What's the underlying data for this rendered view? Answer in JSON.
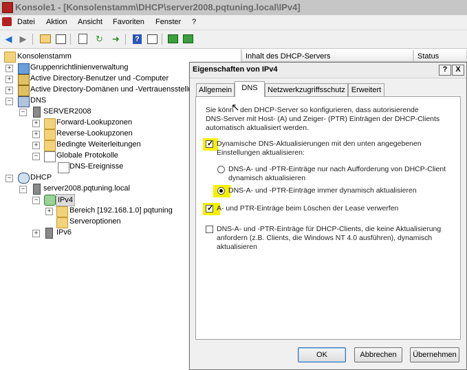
{
  "window": {
    "title": "Konsole1 - [Konsolenstamm\\DHCP\\server2008.pqtuning.local\\IPv4]"
  },
  "menu": [
    "Datei",
    "Aktion",
    "Ansicht",
    "Favoriten",
    "Fenster",
    "?"
  ],
  "toolbar": [
    "back-icon",
    "forward-icon",
    "up-folder-icon",
    "show-tree-icon",
    "properties-icon",
    "refresh-icon",
    "export-icon",
    "help-icon",
    "show-action-icon",
    "monitor-icon",
    "network-icon"
  ],
  "tree": {
    "root": "Konsolenstamm",
    "items": [
      "Gruppenrichtlinienverwaltung",
      "Active Directory-Benutzer und -Computer",
      "Active Directory-Domänen und -Vertrauensstellu",
      "DNS",
      "SERVER2008",
      "Forward-Lookupzonen",
      "Reverse-Lookupzonen",
      "Bedingte Weiterleitungen",
      "Globale Protokolle",
      "DNS-Ereignisse",
      "DHCP",
      "server2008.pqtuning.local",
      "IPv4",
      "Bereich [192.168.1.0] pqtuning",
      "Serveroptionen",
      "IPv6"
    ]
  },
  "rightpane": {
    "columns": [
      "Inhalt des DHCP-Servers",
      "Status"
    ]
  },
  "dialog": {
    "title": "Eigenschaften von IPv4",
    "help_btn": "?",
    "close_btn": "X",
    "tabs": [
      "Allgemein",
      "DNS",
      "Netzwerkzugriffsschutz",
      "Erweitert"
    ],
    "active_tab": "DNS",
    "intro": [
      "Sie könn",
      "den DHCP-Server so konfigurieren, dass autorisierende",
      "DNS-Server mit Host- (A) und Zeiger- (PTR) Einträgen der DHCP-Clients",
      "automatisch aktualisiert werden."
    ],
    "dyn_update": {
      "label": [
        "Dynamische DNS-Aktualisierungen mit den unten angegebenen",
        "Einstellungen aktualisieren:"
      ],
      "checked": true
    },
    "radio_on_request": {
      "label": [
        "DNS-A- und -PTR-Einträge nur nach Aufforderung von DHCP-Client",
        "dynamisch aktualisieren"
      ],
      "selected": false
    },
    "radio_always": {
      "label": "DNS-A- und -PTR-Einträge immer dynamisch aktualisieren",
      "selected": true
    },
    "discard_lease": {
      "label": "A- und PTR-Einträge beim Löschen der Lease verwerfen",
      "checked": true
    },
    "no_update_clients": {
      "label": [
        "DNS-A- und -PTR-Einträge für DHCP-Clients, die keine Aktualisierung",
        "anfordern (z.B. Clients, die Windows NT 4.0 ausführen), dynamisch",
        "aktualisieren"
      ],
      "checked": false
    },
    "buttons": {
      "ok": "OK",
      "cancel": "Abbrechen",
      "apply": "Übernehmen"
    },
    "highlight_color": "#f4f100"
  }
}
